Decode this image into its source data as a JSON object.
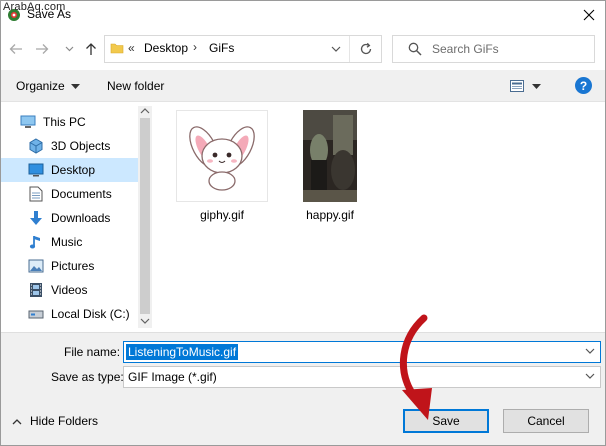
{
  "watermark": "ArabAq.com",
  "window": {
    "title": "Save As"
  },
  "address": {
    "chevrons": "«",
    "crumbs": [
      "Desktop",
      "GiFs"
    ],
    "separator": "›"
  },
  "search": {
    "placeholder": "Search GiFs"
  },
  "toolbar": {
    "organize_label": "Organize",
    "new_folder_label": "New folder",
    "help_label": "?"
  },
  "nav": {
    "items": [
      {
        "label": "This PC",
        "icon": "pc-icon"
      },
      {
        "label": "3D Objects",
        "icon": "cube-icon"
      },
      {
        "label": "Desktop",
        "icon": "desktop-icon",
        "selected": true
      },
      {
        "label": "Documents",
        "icon": "documents-icon"
      },
      {
        "label": "Downloads",
        "icon": "download-arrow-icon"
      },
      {
        "label": "Music",
        "icon": "music-note-icon"
      },
      {
        "label": "Pictures",
        "icon": "pictures-icon"
      },
      {
        "label": "Videos",
        "icon": "film-icon"
      },
      {
        "label": "Local Disk (C:)",
        "icon": "disk-icon"
      }
    ]
  },
  "files": [
    {
      "name": "giphy.gif",
      "thumbnail": "bunny-cartoon"
    },
    {
      "name": "happy.gif",
      "thumbnail": "dark-scene-photo"
    }
  ],
  "form": {
    "file_name_label": "File name:",
    "file_name_value": "ListeningToMusic.gif",
    "save_type_label": "Save as type:",
    "save_type_value": "GIF Image (*.gif)"
  },
  "footer": {
    "hide_folders_label": "Hide Folders",
    "save_label": "Save",
    "cancel_label": "Cancel"
  },
  "colors": {
    "accent": "#0078d7",
    "selection": "#cce8ff",
    "annotation_arrow": "#c0141a"
  }
}
